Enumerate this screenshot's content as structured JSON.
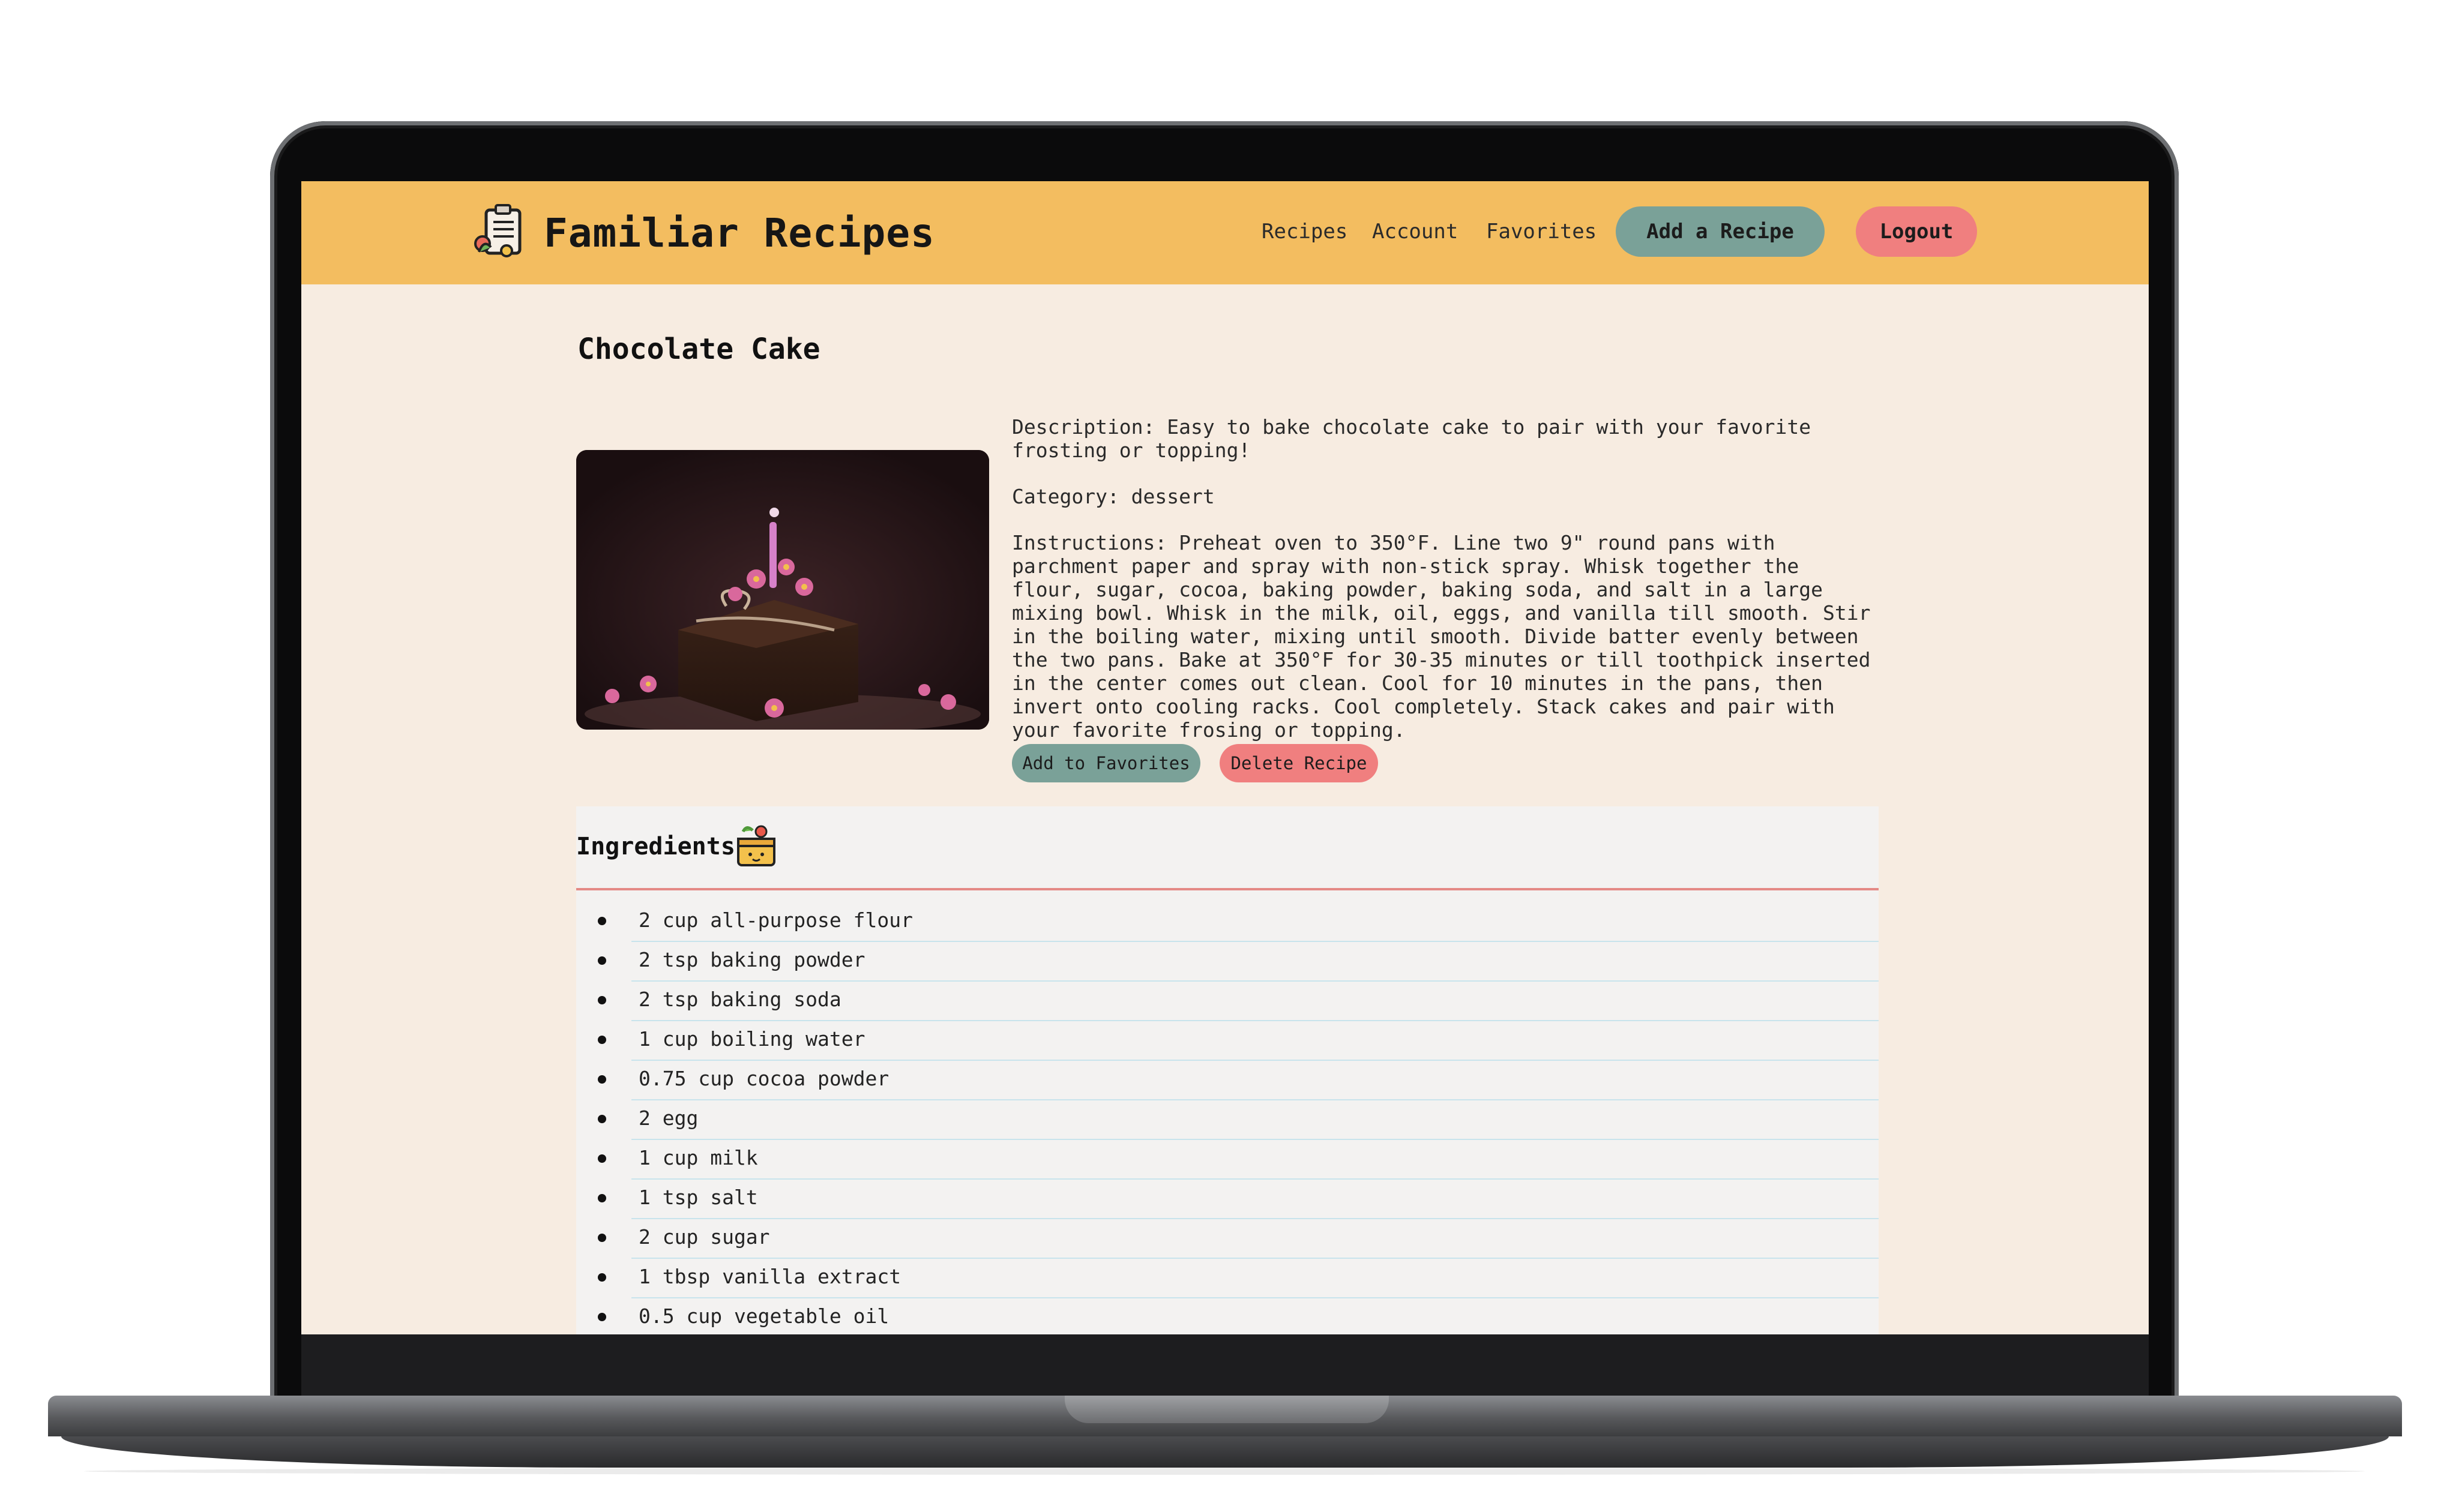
{
  "header": {
    "brand": "Familiar Recipes",
    "nav": [
      "Recipes",
      "Account",
      "Favorites"
    ],
    "add_recipe": "Add a Recipe",
    "logout": "Logout"
  },
  "recipe": {
    "title": "Chocolate Cake",
    "description": "Description: Easy to bake chocolate cake to pair with your favorite frosting or topping!",
    "category": "Category: dessert",
    "instructions": "Instructions: Preheat oven to 350°F. Line two 9\" round pans with parchment paper and spray with non-stick spray. Whisk together the flour, sugar, cocoa, baking powder, baking soda, and salt in a large mixing bowl. Whisk in the milk, oil, eggs, and vanilla till smooth. Stir in the boiling water, mixing until smooth. Divide batter evenly between the two pans. Bake at 350°F for 30-35 minutes or till toothpick inserted in the center comes out clean. Cool for 10 minutes in the pans, then invert onto cooling racks. Cool completely. Stack cakes and pair with your favorite frosing or topping.",
    "add_favorites": "Add to Favorites",
    "delete_recipe": "Delete Recipe"
  },
  "ingredients": {
    "heading": "Ingredients",
    "items": [
      "2 cup all-purpose flour",
      "2 tsp baking powder",
      "2 tsp baking soda",
      "1 cup boiling water",
      "0.75 cup cocoa powder",
      "2 egg",
      "1 cup milk",
      "1 tsp salt",
      "2 cup sugar",
      "1 tbsp vanilla extract",
      "0.5 cup vegetable oil"
    ]
  },
  "colors": {
    "header": "#f3bd60",
    "page": "#f7ece1",
    "green_button": "#7aa198",
    "red_button": "#f07f7f"
  }
}
